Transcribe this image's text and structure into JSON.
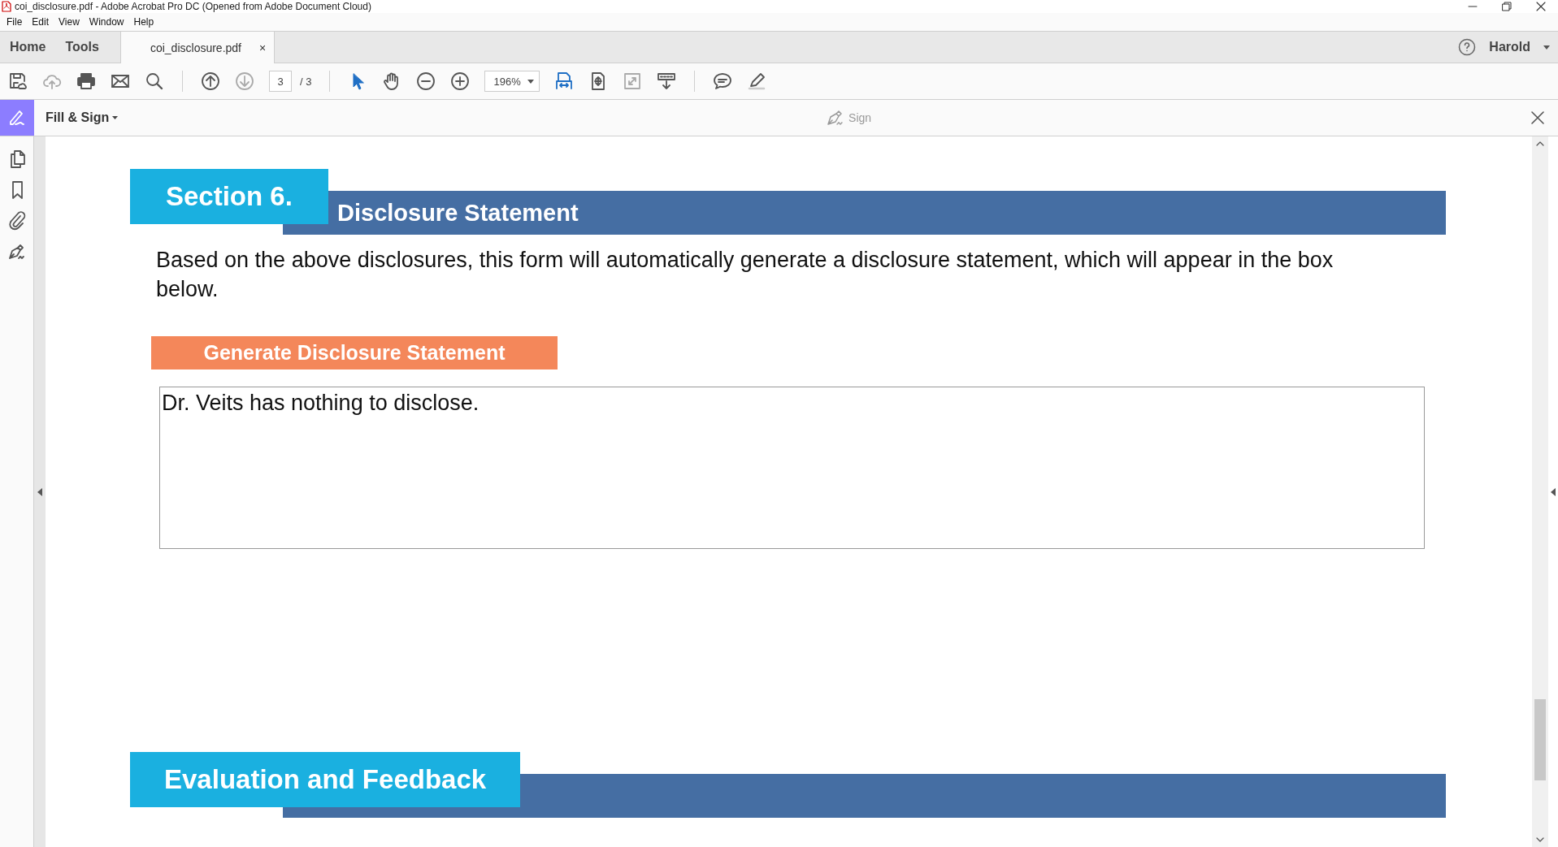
{
  "window": {
    "title": "coi_disclosure.pdf - Adobe Acrobat Pro DC (Opened from Adobe Document Cloud)"
  },
  "menu": [
    "File",
    "Edit",
    "View",
    "Window",
    "Help"
  ],
  "nav_tabs": [
    {
      "label": "Home",
      "selected": false
    },
    {
      "label": "Tools",
      "selected": false
    },
    {
      "label": "coi_disclosure.pdf",
      "selected": true,
      "close": "×"
    }
  ],
  "account": {
    "name": "Harold"
  },
  "toolbar": {
    "page_current": "3",
    "page_total": "/ 3",
    "zoom": "196%"
  },
  "tool_panel": {
    "title": "Fill & Sign",
    "sign": "Sign"
  },
  "document": {
    "sections": [
      {
        "label": "Section 6.",
        "title": "Disclosure Statement",
        "body": "Based on the above disclosures, this form will automatically generate a disclosure statement, which will appear in the box below.",
        "action": "Generate Disclosure Statement",
        "statement": "Dr. Veits has nothing to disclose."
      },
      {
        "label": "Evaluation and Feedback"
      }
    ]
  }
}
